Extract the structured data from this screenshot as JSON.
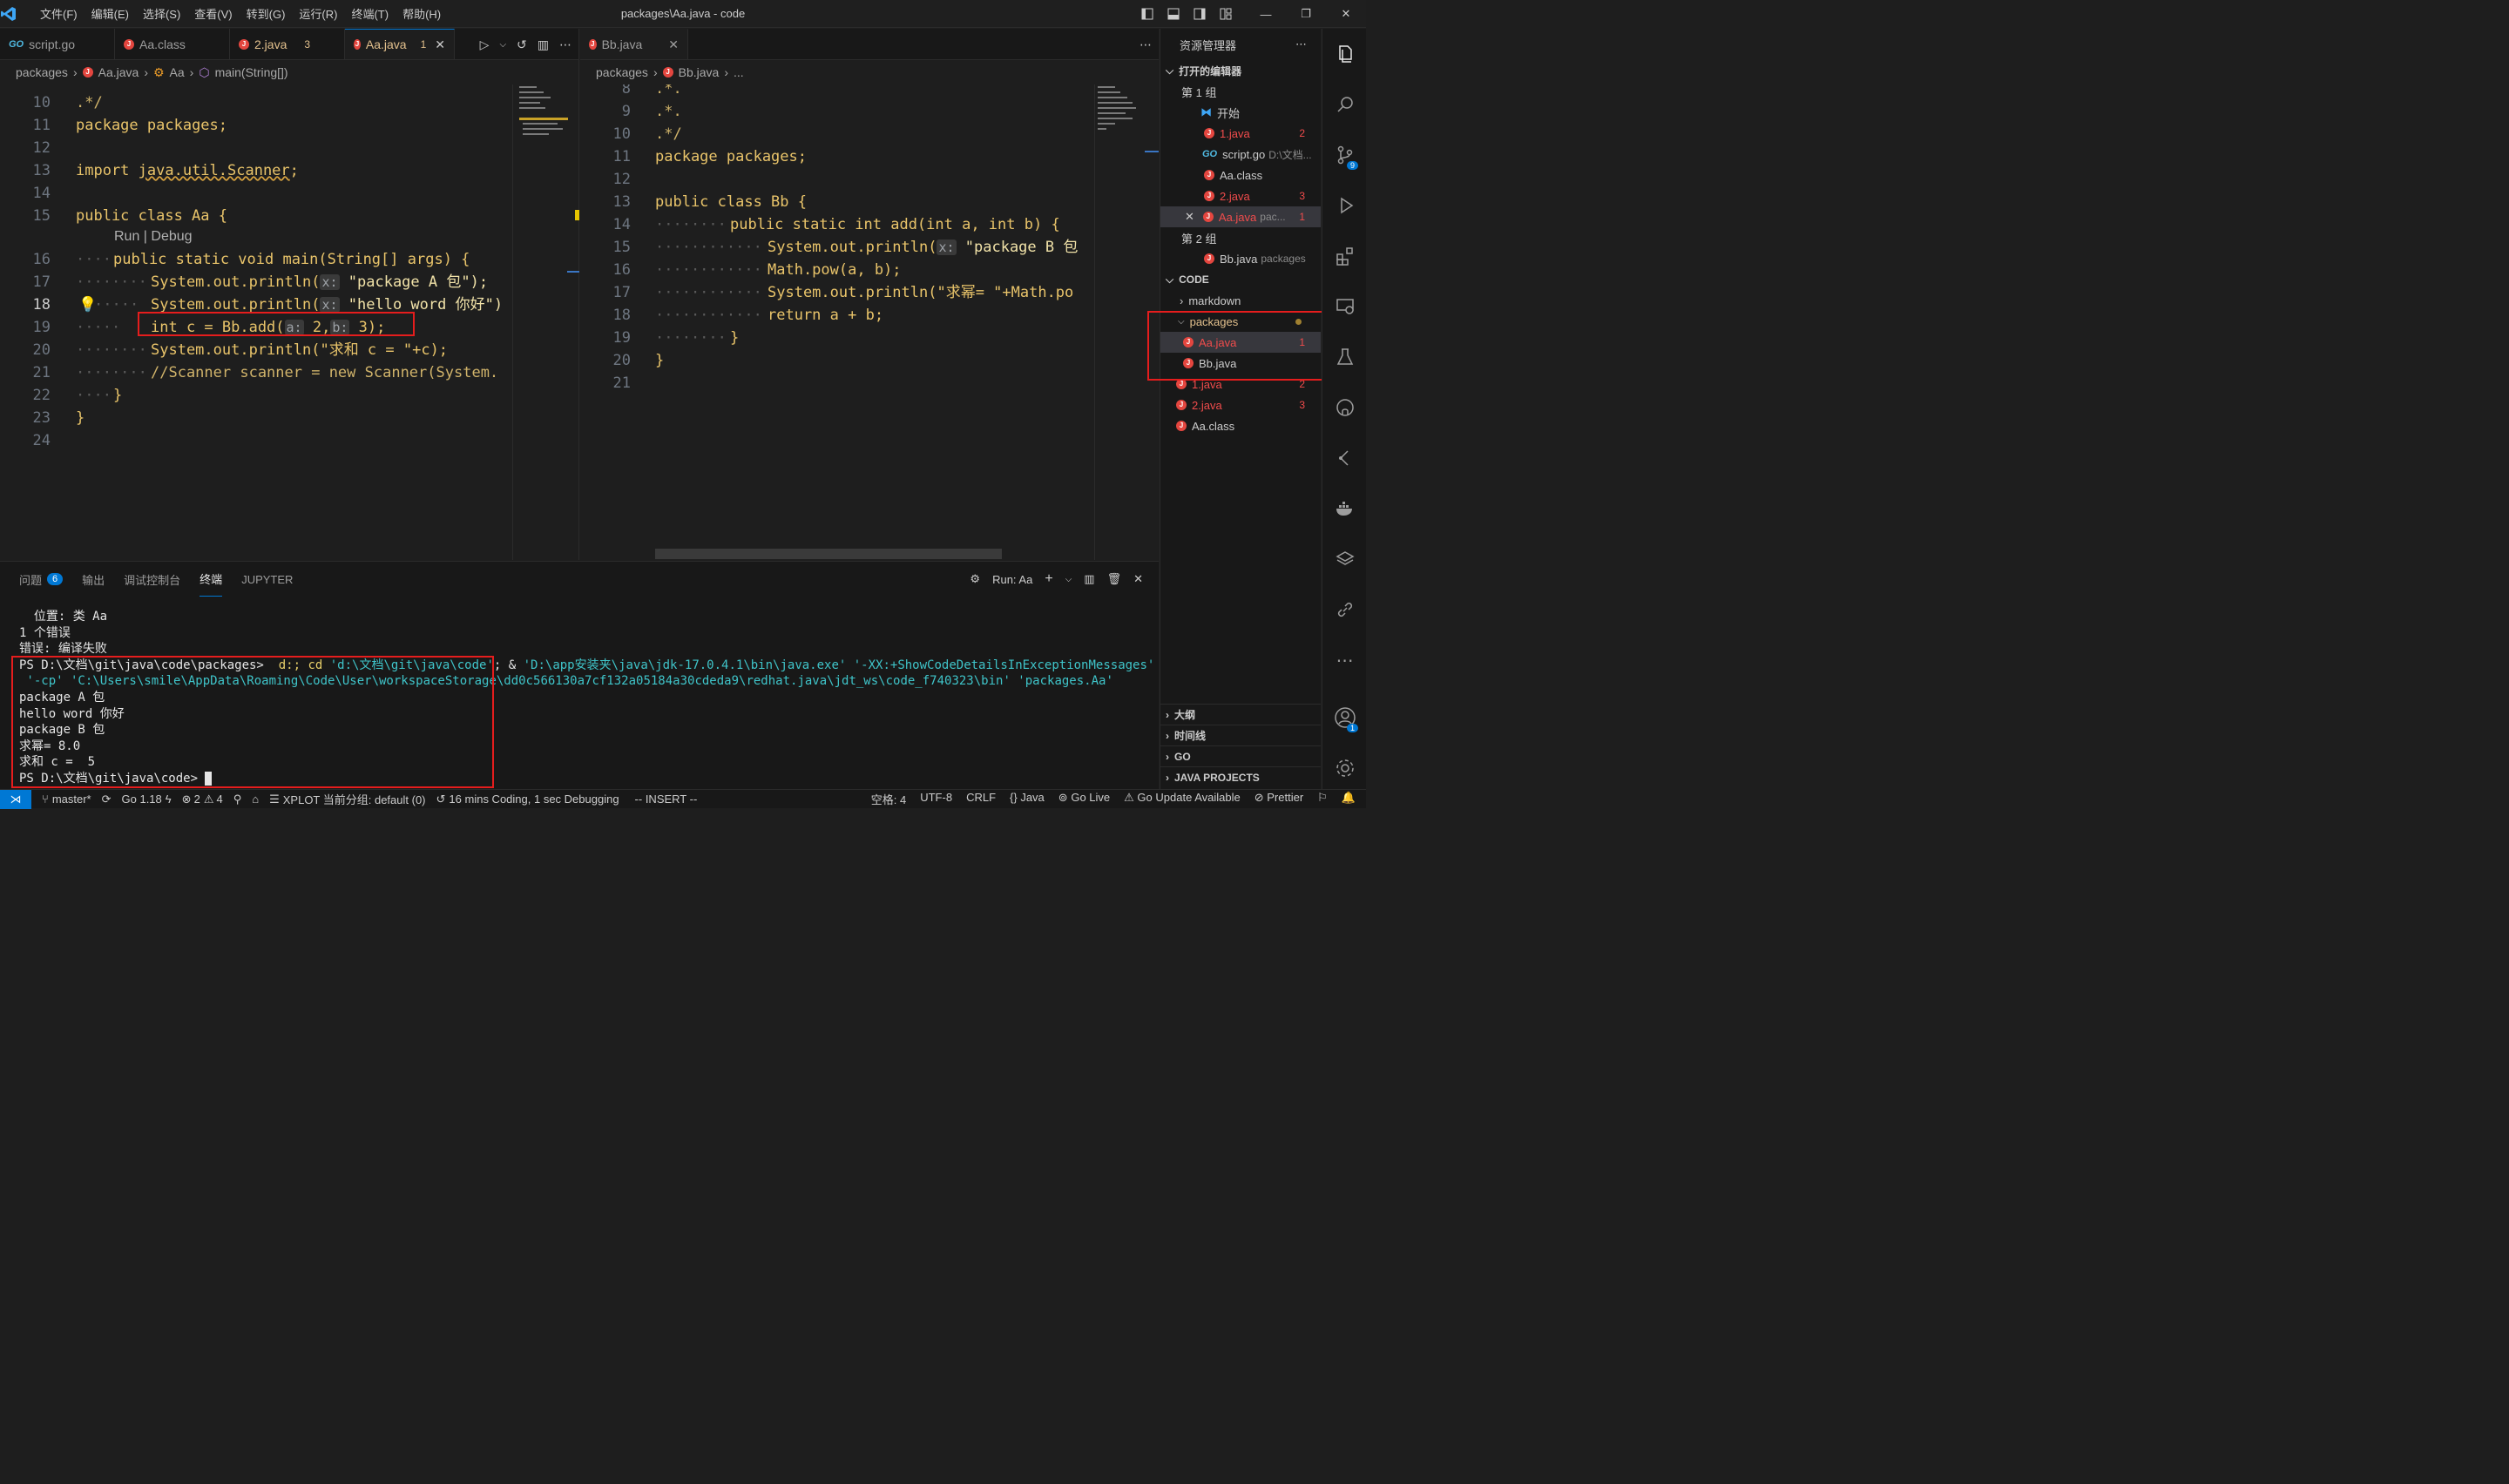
{
  "titlebar": {
    "menus": [
      "文件(F)",
      "编辑(E)",
      "选择(S)",
      "查看(V)",
      "转到(G)",
      "运行(R)",
      "终端(T)",
      "帮助(H)"
    ],
    "title": "packages\\Aa.java - code",
    "minimize": "—",
    "restore": "❐",
    "close": "✕"
  },
  "group1": {
    "tabs": [
      {
        "label": "script.go",
        "icon": "go-icon"
      },
      {
        "label": "Aa.class",
        "icon": "java-icon"
      },
      {
        "label": "2.java",
        "icon": "java-icon",
        "count": "3"
      },
      {
        "label": "Aa.java",
        "icon": "java-icon",
        "count": "1",
        "active": true
      }
    ],
    "breadcrumb": [
      "packages",
      "Aa.java",
      "Aa",
      "main(String[])"
    ],
    "lines": [
      "10",
      "11",
      "12",
      "13",
      "14",
      "15",
      "16",
      "17",
      "18",
      "19",
      "20",
      "21",
      "22",
      "23",
      "24"
    ],
    "code": {
      "l10": ".*/",
      "l11a": "package",
      "l11b": " packages;",
      "l13a": "import ",
      "l13b": "java.util.Scanner",
      "l13c": ";",
      "l15": "public class Aa {",
      "lens": "Run | Debug",
      "l16": "public static void main(String[] args) {",
      "l17a": "System.out.println(",
      "l17h": "x:",
      "l17b": " \"package A 包\");",
      "l18a": "System.out.println(",
      "l18h": "x:",
      "l18b": " \"hello word 你好\")",
      "l19a": "int c = Bb.add(",
      "l19h1": "a:",
      "l19b": " 2,",
      "l19h2": "b:",
      "l19c": " 3);",
      "l20": "System.out.println(\"求和 c = \"+c);",
      "l21": "//Scanner scanner = new Scanner(System.",
      "l22": "}",
      "l23": "}"
    }
  },
  "group2": {
    "tabs": [
      {
        "label": "Bb.java",
        "icon": "java-icon"
      }
    ],
    "breadcrumb": [
      "packages",
      "Bb.java",
      "..."
    ],
    "lines": [
      "8",
      "9",
      "10",
      "11",
      "12",
      "13",
      "14",
      "15",
      "16",
      "17",
      "18",
      "19",
      "20",
      "21"
    ],
    "code": {
      "l8": ".*.",
      "l9": ".*.",
      "l10": ".*/",
      "l11": "package packages;",
      "l13": "public class Bb {",
      "l14": "public static int add(int a, int b) {",
      "l15a": "System.out.println(",
      "l15h": "x:",
      "l15b": " \"package B 包",
      "l16": "Math.pow(a, b);",
      "l17": "System.out.println(\"求幂= \"+Math.po",
      "l18": "return a + b;",
      "l19": "}",
      "l20": "}"
    }
  },
  "panel": {
    "tabs": [
      {
        "label": "问题",
        "badge": "6"
      },
      {
        "label": "输出"
      },
      {
        "label": "调试控制台"
      },
      {
        "label": "终端",
        "active": true
      },
      {
        "label": "JUPYTER"
      }
    ],
    "run_label": "Run: Aa",
    "terminal": {
      "t1": "  位置: 类 Aa",
      "t2": "1 个错误",
      "t3": "错误: 编译失败",
      "t4a": "PS D:\\文档\\git\\java\\code\\packages> ",
      "t4b": " d:; cd ",
      "t4c": "'d:\\文档\\git\\java\\code'",
      "t4d": "; & ",
      "t4e": "'D:\\app安装夹\\java\\jdk-17.0.4.1\\bin\\java.exe' '-XX:+ShowCodeDetailsInExceptionMessages'",
      "t5": " '-cp' 'C:\\Users\\smile\\AppData\\Roaming\\Code\\User\\workspaceStorage\\dd0c566130a7cf132a05184a30cdeda9\\redhat.java\\jdt_ws\\code_f740323\\bin' 'packages.Aa'",
      "t6": "package A 包",
      "t7": "hello word 你好",
      "t8": "package B 包",
      "t9": "求幂= 8.0",
      "t10": "求和 c =  5",
      "t11": "PS D:\\文档\\git\\java\\code> "
    }
  },
  "sidebar": {
    "title": "资源管理器",
    "open_editors": "打开的编辑器",
    "group1": "第 1 组",
    "group2": "第 2 组",
    "open_items": [
      {
        "label": "开始",
        "icon": "vscode-icon"
      },
      {
        "label": "1.java",
        "count": "2",
        "error": true
      },
      {
        "label": "script.go",
        "desc": "D:\\文档...",
        "icon": "go-icon"
      },
      {
        "label": "Aa.class"
      },
      {
        "label": "2.java",
        "count": "3",
        "error": true
      },
      {
        "label": "Aa.java",
        "desc": "pac...",
        "count": "1",
        "error": true,
        "close": "✕"
      }
    ],
    "g2_items": [
      {
        "label": "Bb.java",
        "desc": "packages"
      }
    ],
    "code_section": "CODE",
    "tree": {
      "markdown": "markdown",
      "packages": "packages",
      "aa": "Aa.java",
      "aa_count": "1",
      "bb": "Bb.java",
      "j1": "1.java",
      "j1_count": "2",
      "j2": "2.java",
      "j2_count": "3",
      "aaclass": "Aa.class"
    },
    "sections": [
      "大纲",
      "时间线",
      "GO",
      "JAVA PROJECTS"
    ]
  },
  "activity": {
    "scm_badge": "9",
    "account_badge": "1"
  },
  "statusbar": {
    "branch": "master*",
    "go": "Go 1.18",
    "errors": "2",
    "warnings": "4",
    "xplot": "XPLOT 当前分组: default (0)",
    "time": "16 mins Coding, 1 sec Debugging",
    "mode": "-- INSERT --",
    "spaces": "空格: 4",
    "encoding": "UTF-8",
    "eol": "CRLF",
    "lang": "Java",
    "golive": "Go Live",
    "goupdate": "Go Update Available",
    "prettier": "Prettier"
  }
}
